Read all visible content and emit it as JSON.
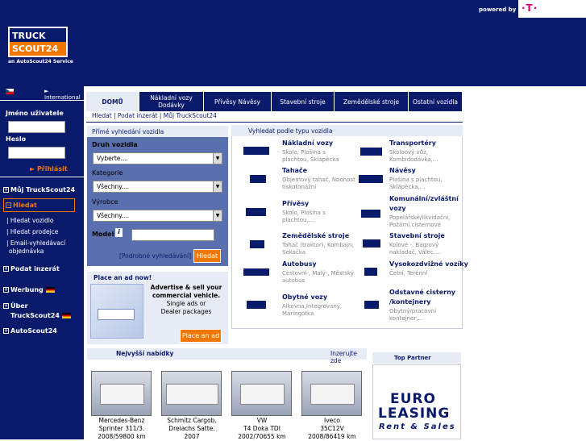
{
  "header": {
    "logo_line1": "TRUCK",
    "logo_line2": "SCOUT24",
    "logo_sub": "an AutoScout24 Service",
    "powered_by": "powered by",
    "tmobile": "·T·"
  },
  "sidebar": {
    "language": "International",
    "username_label": "Jméno uživatele",
    "password_label": "Heslo",
    "login_button": "Přihlásit",
    "nav_mytruckscout": "Můj TruckScout24",
    "nav_hledat": "Hledat",
    "sub_hledat_vozidlo": "Hledat vozidlo",
    "sub_hledat_prodejce": "Hledat prodejce",
    "sub_email_1": "Email-vyhledávací",
    "sub_email_2": "objednávka",
    "nav_podat": "Podat inzerát",
    "nav_werbung": "Werbung",
    "nav_uber": "Über",
    "nav_uber2": "TruckScout24",
    "nav_autoscout": "AutoScout24"
  },
  "tabs": [
    {
      "label": "DOMŮ",
      "line2": ""
    },
    {
      "label": "Nákladní vozy",
      "line2": "Dodávky"
    },
    {
      "label": "Přívěsy Návěsy",
      "line2": ""
    },
    {
      "label": "Stavební stroje",
      "line2": ""
    },
    {
      "label": "Zemědělské stroje",
      "line2": ""
    },
    {
      "label": "Ostatní vozidla",
      "line2": ""
    }
  ],
  "breadcrumb": "Hledat | Podat inzerát | Můj TruckScout24",
  "direct_search": {
    "title": "Přímé vyhledání vozidla",
    "druh_label": "Druh vozidla",
    "druh_value": "Vyberte....",
    "kategorie_label": "Kategorie",
    "kategorie_value": "Všechny....",
    "vyrobce_label": "Výrobce",
    "vyrobce_value": "Všechny....",
    "model_label": "Model",
    "info_icon": "i",
    "advanced_link": "[Podrobné vyhledávání]",
    "search_button": "Hledat"
  },
  "ad": {
    "title": "Place an ad now!",
    "line1": "Advertise & sell your",
    "line2": "commercial vehicle.",
    "line3": "Single ads or",
    "line4": "Dealer packages",
    "button": "Place an ad"
  },
  "type_search": {
    "title": "Vyhledat podle typu vozidla",
    "categories": [
      {
        "title": "Nákladní vozy",
        "title2": "",
        "desc1": "Skolo, Plošina s",
        "desc2": "plachtou, Sklápěcka"
      },
      {
        "title": "Transportéry",
        "title2": "",
        "desc1": "Skoloový vůz,",
        "desc2": "Kombidodávka,..."
      },
      {
        "title": "Tahače",
        "title2": "",
        "desc1": "Objemový tahač, Noonost",
        "desc2": "tiskotonážní"
      },
      {
        "title": "Návěsy",
        "title2": "",
        "desc1": "Plošina s plachtou,",
        "desc2": "Sklápěcka,..."
      },
      {
        "title": "Přívěsy",
        "title2": "",
        "desc1": "Skolo, Plošina s",
        "desc2": "plachtou,..."
      },
      {
        "title": "Komunální/zvláštní",
        "title2": "vozy",
        "desc1": "Popelářské/likvidační,",
        "desc2": "Požární cisternové"
      },
      {
        "title": "Zemědělské stroje",
        "title2": "",
        "desc1": "Tahač (traktor), Kombajn,",
        "desc2": "Sekačka"
      },
      {
        "title": "Stavební stroje",
        "title2": "",
        "desc1": "Kolové -, Bagrový",
        "desc2": "nakladač, Válec,..."
      },
      {
        "title": "Autobusy",
        "title2": "",
        "desc1": "Cestovní-, Malý-, Městský",
        "desc2": "autobus"
      },
      {
        "title": "Vysokozdvižné vozíky",
        "title2": "",
        "desc1": "Čelní, Terénní",
        "desc2": ""
      },
      {
        "title": "Obytné vozy",
        "title2": "",
        "desc1": "Alkovna,Integrovaný,",
        "desc2": "Maringotka"
      },
      {
        "title": "Odstavné cisterny",
        "title2": "/kontejnery",
        "desc1": "Obytný/pracovní",
        "desc2": "kontejner,..."
      }
    ]
  },
  "offers": {
    "title": "Nejvyšší nabídky",
    "link": "Inzerujte zde",
    "items": [
      {
        "line1": "Mercedes-Benz",
        "line2": "Sprinter 311/3.",
        "line3": "2008/59800 km"
      },
      {
        "line1": "Schmitz Cargob.",
        "line2": "Dreiachs Satte.",
        "line3": "2007"
      },
      {
        "line1": "VW",
        "line2": "T4 Doka TDI",
        "line3": "2002/70655 km"
      },
      {
        "line1": "Iveco",
        "line2": "35C12V",
        "line3": "2008/86419 km"
      }
    ]
  },
  "partner": {
    "title": "Top Partner",
    "logo1": "EURO",
    "logo2": "LEASING",
    "logo3": "Rent & Sales"
  }
}
